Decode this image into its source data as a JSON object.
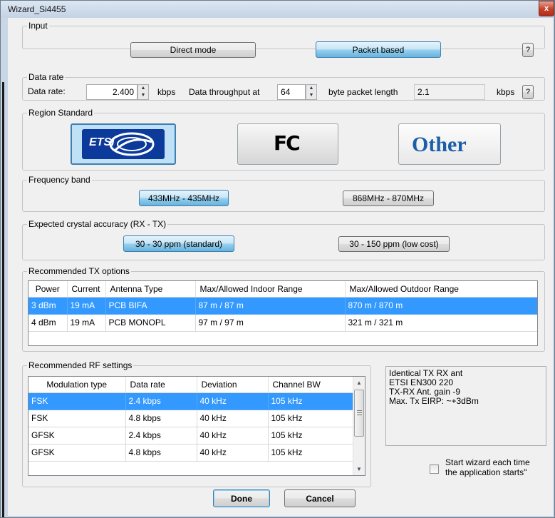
{
  "window": {
    "title": "Wizard_Si4455",
    "close_glyph": "x"
  },
  "input": {
    "legend": "Input",
    "direct_mode_label": "Direct mode",
    "packet_based_label": "Packet based",
    "help_label": "?"
  },
  "data_rate": {
    "legend": "Data rate",
    "label": "Data rate:",
    "value": "2.400",
    "unit": "kbps",
    "throughput_label": "Data throughput at",
    "packet_length": "64",
    "packet_length_label": "byte packet length",
    "throughput_value": "2.1",
    "throughput_unit": "kbps",
    "help_label": "?"
  },
  "region": {
    "legend": "Region Standard",
    "etsi_label": "ETSI",
    "fcc_label": "FC",
    "other_label": "Other"
  },
  "frequency": {
    "legend": "Frequency band",
    "band1_label": "433MHz - 435MHz",
    "band2_label": "868MHz - 870MHz"
  },
  "crystal": {
    "legend": "Expected crystal accuracy (RX - TX)",
    "standard_label": "30 - 30 ppm (standard)",
    "lowcost_label": "30 - 150 ppm (low cost)"
  },
  "tx_options": {
    "legend": "Recommended TX options",
    "columns": [
      "Power",
      "Current",
      "Antenna Type",
      "Max/Allowed Indoor Range",
      "Max/Allowed Outdoor Range"
    ],
    "rows": [
      [
        "3 dBm",
        "19 mA",
        "PCB BIFA",
        "87 m / 87 m",
        "870 m / 870 m"
      ],
      [
        "4 dBm",
        "19 mA",
        "PCB MONOPL",
        "97 m / 97 m",
        "321 m / 321 m"
      ]
    ]
  },
  "rf_settings": {
    "legend": "Recommended RF settings",
    "columns": [
      "Modulation type",
      "Data rate",
      "Deviation",
      "Channel BW"
    ],
    "rows": [
      [
        "FSK",
        "2.4 kbps",
        "40 kHz",
        "105 kHz"
      ],
      [
        "FSK",
        "4.8 kbps",
        "40 kHz",
        "105 kHz"
      ],
      [
        "GFSK",
        "2.4 kbps",
        "40 kHz",
        "105 kHz"
      ],
      [
        "GFSK",
        "4.8 kbps",
        "40 kHz",
        "105 kHz"
      ]
    ]
  },
  "info": {
    "line1": "Identical TX RX ant",
    "line2": "ETSI EN300 220",
    "line3": "TX-RX Ant. gain -9",
    "line4": "Max. Tx EIRP: ~+3dBm"
  },
  "startup": {
    "line1": "Start wizard each time",
    "line2": "the application starts\""
  },
  "footer": {
    "done_label": "Done",
    "cancel_label": "Cancel"
  },
  "colors": {
    "selection": "#3399ff",
    "button_selected": "#98d1ef",
    "window_frame": "#c9d6e6"
  }
}
